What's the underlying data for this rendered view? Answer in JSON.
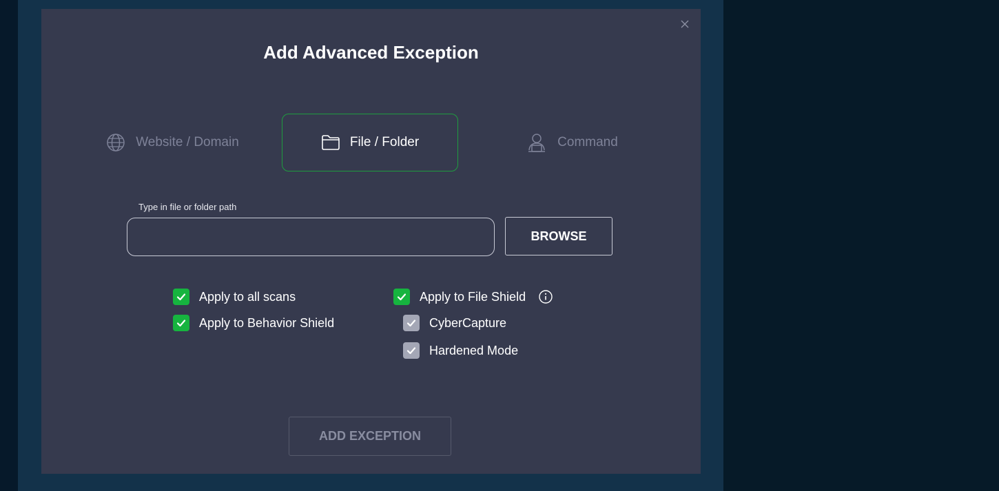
{
  "dialog": {
    "title": "Add Advanced Exception",
    "close_icon": "close-icon"
  },
  "tabs": [
    {
      "label": "Website / Domain",
      "icon": "globe-icon",
      "selected": false
    },
    {
      "label": "File / Folder",
      "icon": "folder-icon",
      "selected": true
    },
    {
      "label": "Command",
      "icon": "command-icon",
      "selected": false
    }
  ],
  "path_field": {
    "label": "Type in file or folder path",
    "value": "",
    "placeholder": ""
  },
  "browse_button": {
    "label": "BROWSE"
  },
  "options": {
    "apply_all_scans": {
      "label": "Apply to all scans",
      "checked": true
    },
    "apply_behavior_shield": {
      "label": "Apply to Behavior Shield",
      "checked": true
    },
    "apply_file_shield": {
      "label": "Apply to File Shield",
      "checked": true
    },
    "cybercapture": {
      "label": "CyberCapture",
      "checked": true
    },
    "hardened_mode": {
      "label": "Hardened Mode",
      "checked": true
    }
  },
  "add_exception_button": {
    "label": "ADD EXCEPTION"
  },
  "colors": {
    "accent_green": "#16b43f",
    "dialog_bg": "#363a4e",
    "app_bg": "#13324a",
    "outer_bg": "#061a28"
  }
}
